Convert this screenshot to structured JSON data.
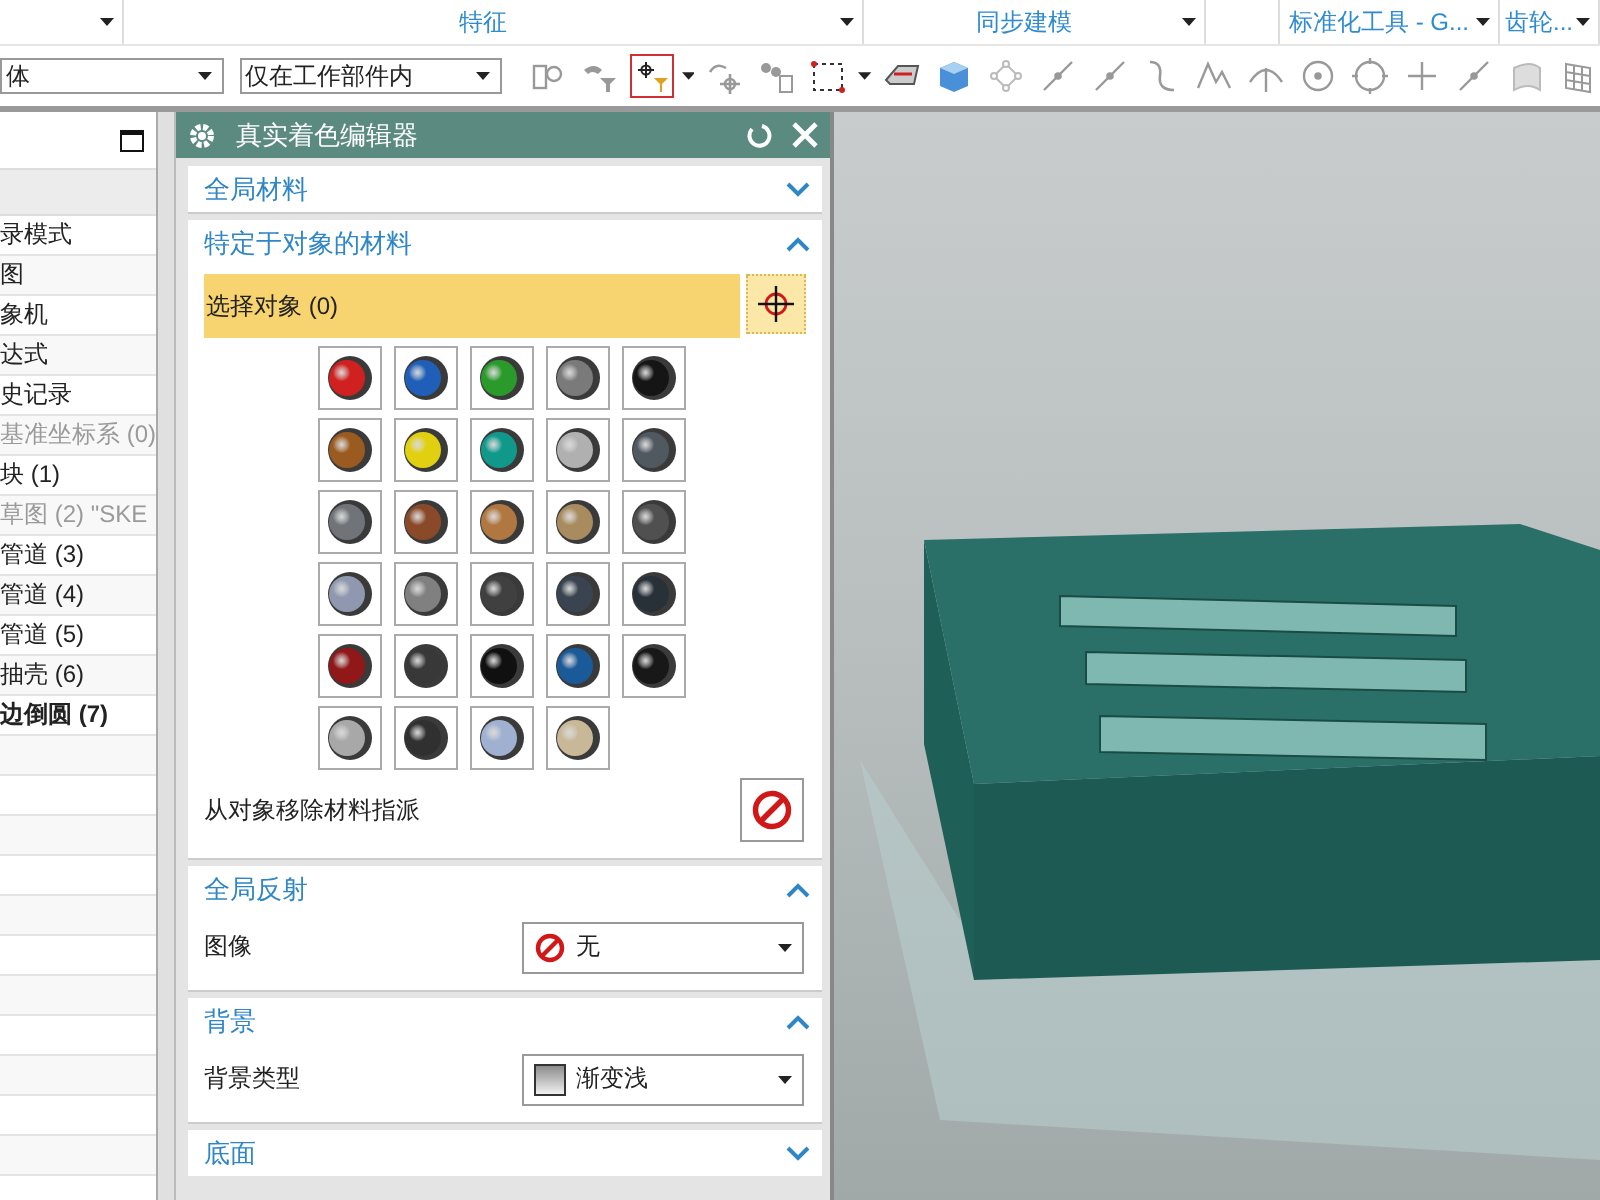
{
  "ribbon_groups": [
    {
      "caret": true
    },
    {
      "label": "特征",
      "caret": true
    },
    {
      "label": "同步建模",
      "caret": true
    },
    {
      "caret": false
    },
    {
      "label": "标准化工具 - G...",
      "caret": true
    },
    {
      "label": "齿轮...",
      "caret": true
    }
  ],
  "filters": [
    {
      "value": "体"
    },
    {
      "value": "仅在工作部件内"
    }
  ],
  "toolbar": [
    {
      "kind": "assembly",
      "selected": false,
      "caret": false
    },
    {
      "kind": "filter",
      "selected": false,
      "caret": false
    },
    {
      "kind": "snap",
      "selected": true,
      "caret": true
    },
    {
      "kind": "rotate",
      "selected": false,
      "caret": false
    },
    {
      "kind": "parts",
      "selected": false,
      "caret": false
    },
    {
      "kind": "marquee",
      "selected": false,
      "caret": true
    },
    {
      "kind": "eraser",
      "selected": false,
      "caret": false
    },
    {
      "kind": "cube",
      "selected": false,
      "caret": false
    },
    {
      "kind": "nodes",
      "selected": false,
      "caret": false
    },
    {
      "kind": "line",
      "selected": false,
      "caret": false
    },
    {
      "kind": "line",
      "selected": false,
      "caret": false
    },
    {
      "kind": "curve",
      "selected": false,
      "caret": false
    },
    {
      "kind": "spline",
      "selected": false,
      "caret": false
    },
    {
      "kind": "arc",
      "selected": false,
      "caret": false
    },
    {
      "kind": "circle",
      "selected": false,
      "caret": false
    },
    {
      "kind": "ring",
      "selected": false,
      "caret": false
    },
    {
      "kind": "cross",
      "selected": false,
      "caret": false
    },
    {
      "kind": "line",
      "selected": false,
      "caret": false
    },
    {
      "kind": "face",
      "selected": false,
      "caret": false
    },
    {
      "kind": "grid",
      "selected": false,
      "caret": false
    }
  ],
  "navigator": {
    "rows": [
      {
        "label": "录模式",
        "dimmed": false,
        "bold": false
      },
      {
        "label": "图",
        "dimmed": false,
        "bold": false
      },
      {
        "label": "象机",
        "dimmed": false,
        "bold": false
      },
      {
        "label": "达式",
        "dimmed": false,
        "bold": false
      },
      {
        "label": "史记录",
        "dimmed": false,
        "bold": false
      },
      {
        "label": "基准坐标系 (0)",
        "dimmed": true,
        "bold": false
      },
      {
        "label": "块 (1)",
        "dimmed": false,
        "bold": false
      },
      {
        "label": "草图 (2) \"SKE",
        "dimmed": true,
        "bold": false
      },
      {
        "label": "管道 (3)",
        "dimmed": false,
        "bold": false
      },
      {
        "label": "管道 (4)",
        "dimmed": false,
        "bold": false
      },
      {
        "label": "管道 (5)",
        "dimmed": false,
        "bold": false
      },
      {
        "label": "抽壳 (6)",
        "dimmed": false,
        "bold": false
      },
      {
        "label": "边倒圆 (7)",
        "dimmed": false,
        "bold": true
      }
    ]
  },
  "dialog": {
    "title": "真实着色编辑器",
    "sections": [
      {
        "kind": "plain",
        "title": "全局材料",
        "expanded": false
      },
      {
        "kind": "materials",
        "title": "特定于对象的材料",
        "expanded": true,
        "select_label": "选择对象 (0)",
        "remove_label": "从对象移除材料指派",
        "materials": [
          {
            "color": "#d02020"
          },
          {
            "color": "#1f5fb8"
          },
          {
            "color": "#2a9a2a"
          },
          {
            "color": "#7a7a7a"
          },
          {
            "color": "#151515"
          },
          {
            "color": "#9a5a20"
          },
          {
            "color": "#e0d010"
          },
          {
            "color": "#10988a"
          },
          {
            "color": "#b0b0b0"
          },
          {
            "color": "#505860"
          },
          {
            "color": "#707478"
          },
          {
            "color": "#8a4a2a"
          },
          {
            "color": "#b07840"
          },
          {
            "color": "#a88c60"
          },
          {
            "color": "#505050"
          },
          {
            "color": "#9098b0"
          },
          {
            "color": "#808080"
          },
          {
            "color": "#404040"
          },
          {
            "color": "#3a4450"
          },
          {
            "color": "#283038"
          },
          {
            "color": "#901818"
          },
          {
            "color": "#383838"
          },
          {
            "color": "#101010"
          },
          {
            "color": "#1a5a98"
          },
          {
            "color": "#181818"
          },
          {
            "color": "#a8a8a8"
          },
          {
            "color": "#303030"
          },
          {
            "color": "#a0b0d0"
          },
          {
            "color": "#c8b898"
          }
        ]
      },
      {
        "kind": "reflection",
        "title": "全局反射",
        "expanded": true,
        "label": "图像",
        "value": "无"
      },
      {
        "kind": "background",
        "title": "背景",
        "expanded": true,
        "label": "背景类型",
        "value": "渐变浅"
      },
      {
        "kind": "plain",
        "title": "底面",
        "expanded": false
      }
    ]
  }
}
